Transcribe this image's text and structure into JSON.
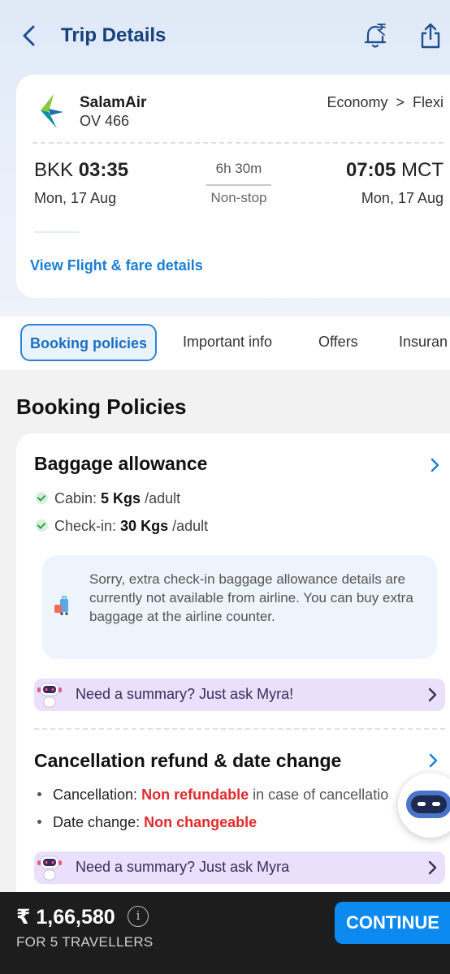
{
  "header": {
    "title": "Trip Details"
  },
  "flight": {
    "airline": "SalamAir",
    "flight_no": "OV 466",
    "fare_class": "Economy  >  Flexi",
    "dep_code": "BKK",
    "dep_time": "03:35",
    "dep_date": "Mon, 17 Aug",
    "duration": "6h 30m",
    "stops": "Non-stop",
    "arr_time": "07:05",
    "arr_code": "MCT",
    "arr_date": "Mon, 17 Aug",
    "view_link": "View Flight & fare details"
  },
  "tabs": [
    "Booking policies",
    "Important info",
    "Offers",
    "Insuran"
  ],
  "section_title": "Booking Policies",
  "baggage": {
    "heading": "Baggage allowance",
    "cabin_label": "Cabin:",
    "cabin_value": "5 Kgs",
    "cabin_unit": "/adult",
    "checkin_label": "Check-in:",
    "checkin_value": "30 Kgs",
    "checkin_unit": "/adult",
    "notice": "Sorry, extra check-in baggage allowance details are currently not available from airline. You can buy extra baggage at the airline counter.",
    "myra": "Need a summary? Just ask Myra!"
  },
  "cancellation": {
    "heading": "Cancellation refund & date change",
    "cancel_label": "Cancellation:",
    "cancel_value": "Non refundable",
    "cancel_rest": "in case of cancellatio",
    "date_label": "Date change:",
    "date_value": "Non changeable",
    "myra": "Need a summary? Just ask Myra"
  },
  "footer": {
    "price": "₹ 1,66,580",
    "info_glyph": "i",
    "travellers": "FOR 5 TRAVELLERS",
    "cta": "CONTINUE"
  },
  "colors": {
    "accent": "#1a7fd6",
    "title": "#15407a",
    "alert": "#e02a2a",
    "myra_bg": "#eae0fb",
    "footer_bg": "#1d1d1d",
    "cta_bg": "#0d8af0"
  },
  "icons": [
    "back-chevron-icon",
    "fare-alert-bell-icon",
    "share-icon",
    "salamair-logo",
    "check-icon",
    "baggage-icon",
    "myra-bot-icon",
    "chevron-right-icon",
    "info-icon"
  ]
}
